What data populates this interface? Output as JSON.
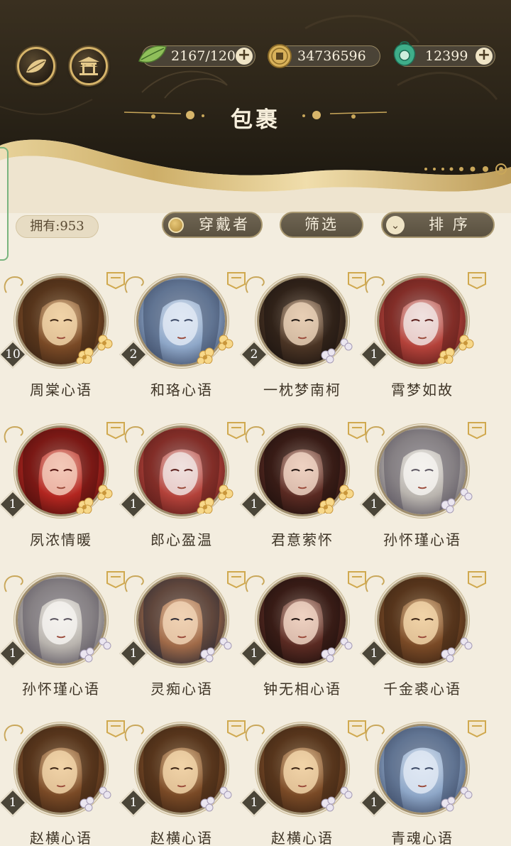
{
  "header": {
    "title": "包裹",
    "resources": [
      {
        "name": "stamina",
        "value": "2167/120",
        "icon": "leaf-icon"
      },
      {
        "name": "coins",
        "value": "34736596",
        "icon": "coin-icon"
      },
      {
        "name": "jade",
        "value": "12399",
        "icon": "jade-icon"
      }
    ],
    "left_buttons": [
      {
        "name": "leaf-menu-button",
        "icon": "leaf-icon"
      },
      {
        "name": "pavilion-button",
        "icon": "pavilion-icon"
      }
    ]
  },
  "toolbar": {
    "owned_label": "拥有:953",
    "wearer_label": "穿戴者",
    "filter_label": "筛选",
    "sort_label": "排 序"
  },
  "items": [
    {
      "name": "周棠心语",
      "count": "10",
      "hue": "warm-brown",
      "flowers": true
    },
    {
      "name": "和珞心语",
      "count": "2",
      "hue": "silver-blue",
      "flowers": true
    },
    {
      "name": "一枕梦南柯",
      "count": "2",
      "hue": "dark-brown",
      "flowers": false
    },
    {
      "name": "霄梦如故",
      "count": "1",
      "hue": "red-silver",
      "flowers": true
    },
    {
      "name": "夙浓情暖",
      "count": "1",
      "hue": "crimson",
      "flowers": true
    },
    {
      "name": "郎心盈温",
      "count": "1",
      "hue": "red-silver",
      "flowers": true
    },
    {
      "name": "君意萦怀",
      "count": "1",
      "hue": "dark-red",
      "flowers": true
    },
    {
      "name": "孙怀瑾心语",
      "count": "1",
      "hue": "white-silver",
      "flowers": false
    },
    {
      "name": "孙怀瑾心语",
      "count": "1",
      "hue": "white-silver",
      "flowers": false
    },
    {
      "name": "灵痴心语",
      "count": "1",
      "hue": "monk",
      "flowers": false
    },
    {
      "name": "钟无相心语",
      "count": "1",
      "hue": "dark-red",
      "flowers": false
    },
    {
      "name": "千金裘心语",
      "count": "1",
      "hue": "warm-brown",
      "flowers": false
    },
    {
      "name": "赵横心语",
      "count": "1",
      "hue": "warm-brown",
      "flowers": false
    },
    {
      "name": "赵横心语",
      "count": "1",
      "hue": "warm-brown",
      "flowers": false
    },
    {
      "name": "赵横心语",
      "count": "1",
      "hue": "warm-brown",
      "flowers": false
    },
    {
      "name": "青魂心语",
      "count": "1",
      "hue": "silver-blue",
      "flowers": false
    }
  ],
  "colors": {
    "header_dark": "#2e261a",
    "gold": "#c9a75a",
    "page_bg": "#f3eddf",
    "pill": "#5f5645"
  }
}
